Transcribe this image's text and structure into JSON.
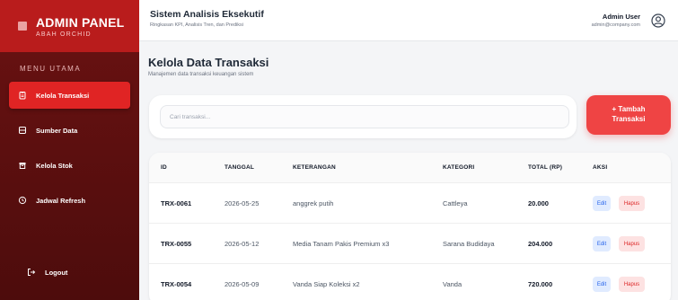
{
  "brand": {
    "title": "ADMIN PANEL",
    "subtitle": "ABAH ORCHID"
  },
  "sidebar": {
    "menu_label": "MENU UTAMA",
    "items": [
      {
        "label": "Kelola Transaksi",
        "icon": "clipboard-icon",
        "active": true
      },
      {
        "label": "Sumber Data",
        "icon": "database-icon",
        "active": false
      },
      {
        "label": "Kelola Stok",
        "icon": "box-icon",
        "active": false
      },
      {
        "label": "Jadwal Refresh",
        "icon": "clock-icon",
        "active": false
      }
    ],
    "logout_label": "Logout"
  },
  "header": {
    "title": "Sistem Analisis Eksekutif",
    "subtitle": "Ringkasan KPI, Analisis Tren, dan Prediksi",
    "user_name": "Admin User",
    "user_email": "admin@company.com"
  },
  "page": {
    "title": "Kelola Data Transaksi",
    "subtitle": "Manajemen data transaksi keuangan sistem"
  },
  "search": {
    "placeholder": "Cari transaksi...",
    "value": ""
  },
  "add_button": {
    "line1": "+ Tambah",
    "line2": "Transaksi"
  },
  "table": {
    "columns": [
      "ID",
      "TANGGAL",
      "KETERANGAN",
      "KATEGORI",
      "TOTAL (RP)",
      "AKSI"
    ],
    "rows": [
      {
        "id": "TRX-0061",
        "tanggal": "2026-05-25",
        "keterangan": "anggrek putih",
        "kategori": "Cattleya",
        "total": "20.000"
      },
      {
        "id": "TRX-0055",
        "tanggal": "2026-05-12",
        "keterangan": "Media Tanam Pakis Premium x3",
        "kategori": "Sarana Budidaya",
        "total": "204.000"
      },
      {
        "id": "TRX-0054",
        "tanggal": "2026-05-09",
        "keterangan": "Vanda Siap Koleksi x2",
        "kategori": "Vanda",
        "total": "720.000"
      }
    ],
    "edit_label": "Edit",
    "delete_label": "Hapus"
  },
  "colors": {
    "sidebar_bg": "#4d0c0c",
    "brand_bg": "#b91c1c",
    "accent": "#ef4444",
    "edit": "#2563eb",
    "delete": "#dc2626"
  }
}
